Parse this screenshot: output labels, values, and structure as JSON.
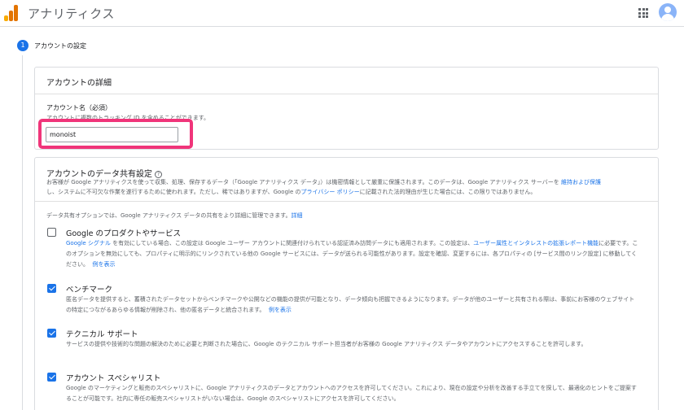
{
  "header": {
    "app_title": "アナリティクス",
    "logo_colors": [
      "#f9ab00",
      "#e37400",
      "#e37400"
    ]
  },
  "step": {
    "number": "1",
    "label": "アカウントの設定"
  },
  "account_details": {
    "title": "アカウントの詳細",
    "field_label": "アカウント名（必須）",
    "field_hint": "アカウントに複数のトラッキング ID を含めることができます。",
    "input_value": "monoist"
  },
  "data_sharing": {
    "title": "アカウントのデータ共有設定",
    "help_icon": "?",
    "intro_line1_a": "お客様が Google アナリティクスを使って収集、処理、保存するデータ（「Google アナリティクス データ」）は機密情報として厳重に保護されます。このデータは、Google アナリティクス サーバーを ",
    "intro_line1_link": "維持および保護",
    "intro_line2_a": "し、システムに不可欠な作業を遂行するために使われます。ただし、稀ではありますが、Google の",
    "intro_line2_link": "プライバシー ポリシー",
    "intro_line2_b": "に記載された法的理由が生じた場合には、この限りではありません。",
    "options_intro": "データ共有オプションでは、Google アナリティクス データの共有をより詳細に管理できます。",
    "options_intro_link": "詳細",
    "options": [
      {
        "title": "Google のプロダクトやサービス",
        "checked": false,
        "desc_link1": "Google シグナル",
        "desc_a": " を有効にしている場合、この設定は Google ユーザー アカウントに関連付けられている認証済み訪問データにも適用されます。この設定は、",
        "desc_link2": "ユーザー属性とインタレストの拡張レポート機能",
        "desc_b": "に必要です。このオプションを無効にしても、プロパティに明示的にリンクされている他の Google サービスには、データが送られる可能性があります。設定を確認、変更するには、各プロパティの [サービス間のリンク設定] に移動してください。",
        "example_link": "例を表示"
      },
      {
        "title": "ベンチマーク",
        "checked": true,
        "desc_a": "匿名データを提供すると、蓄積されたデータセットからベンチマークや公開などの機能の提供が可能となり、データ傾向も把握できるようになります。データが他のユーザーと共有される際は、事前にお客様のウェブサイトの特定につながるあらゆる情報が削除され、他の匿名データと統合されます。",
        "example_link": "例を表示"
      },
      {
        "title": "テクニカル サポート",
        "checked": true,
        "desc_a": "サービスの提供や技術的な問題の解決のために必要と判断された場合に、Google のテクニカル サポート担当者がお客様の Google アナリティクス データやアカウントにアクセスすることを許可します。"
      },
      {
        "title": "アカウント スペシャリスト",
        "checked": true,
        "desc_a": "Google のマーケティングと販売のスペシャリストに、Google アナリティクスのデータとアカウントへのアクセスを許可してください。これにより、現在の設定や分析を改善する手立てを探して、最適化のヒントをご提案することが可能です。社内に専任の販売スペシャリストがいない場合は、Google のスペシャリストにアクセスを許可してください。"
      }
    ]
  }
}
